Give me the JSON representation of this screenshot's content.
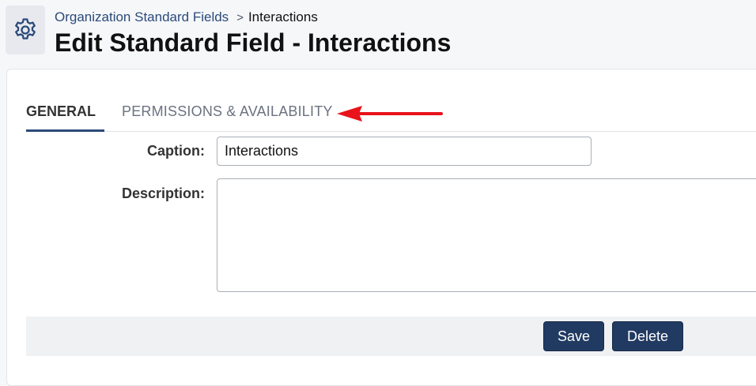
{
  "header": {
    "icon": "gear-icon",
    "breadcrumb": {
      "parent": "Organization Standard Fields",
      "separator": ">",
      "current": "Interactions"
    },
    "title": "Edit Standard Field - Interactions"
  },
  "tabs": [
    {
      "label": "GENERAL",
      "active": true
    },
    {
      "label": "PERMISSIONS & AVAILABILITY",
      "active": false
    }
  ],
  "annotation": {
    "icon": "red-arrow-icon",
    "color": "#e8131b"
  },
  "form": {
    "caption": {
      "label": "Caption:",
      "value": "Interactions"
    },
    "description": {
      "label": "Description:",
      "value": ""
    }
  },
  "actions": {
    "save_label": "Save",
    "delete_label": "Delete"
  },
  "colors": {
    "primary_button": "#213a62",
    "link": "#2b4a7a",
    "tab_underline": "#2b4a7a"
  }
}
